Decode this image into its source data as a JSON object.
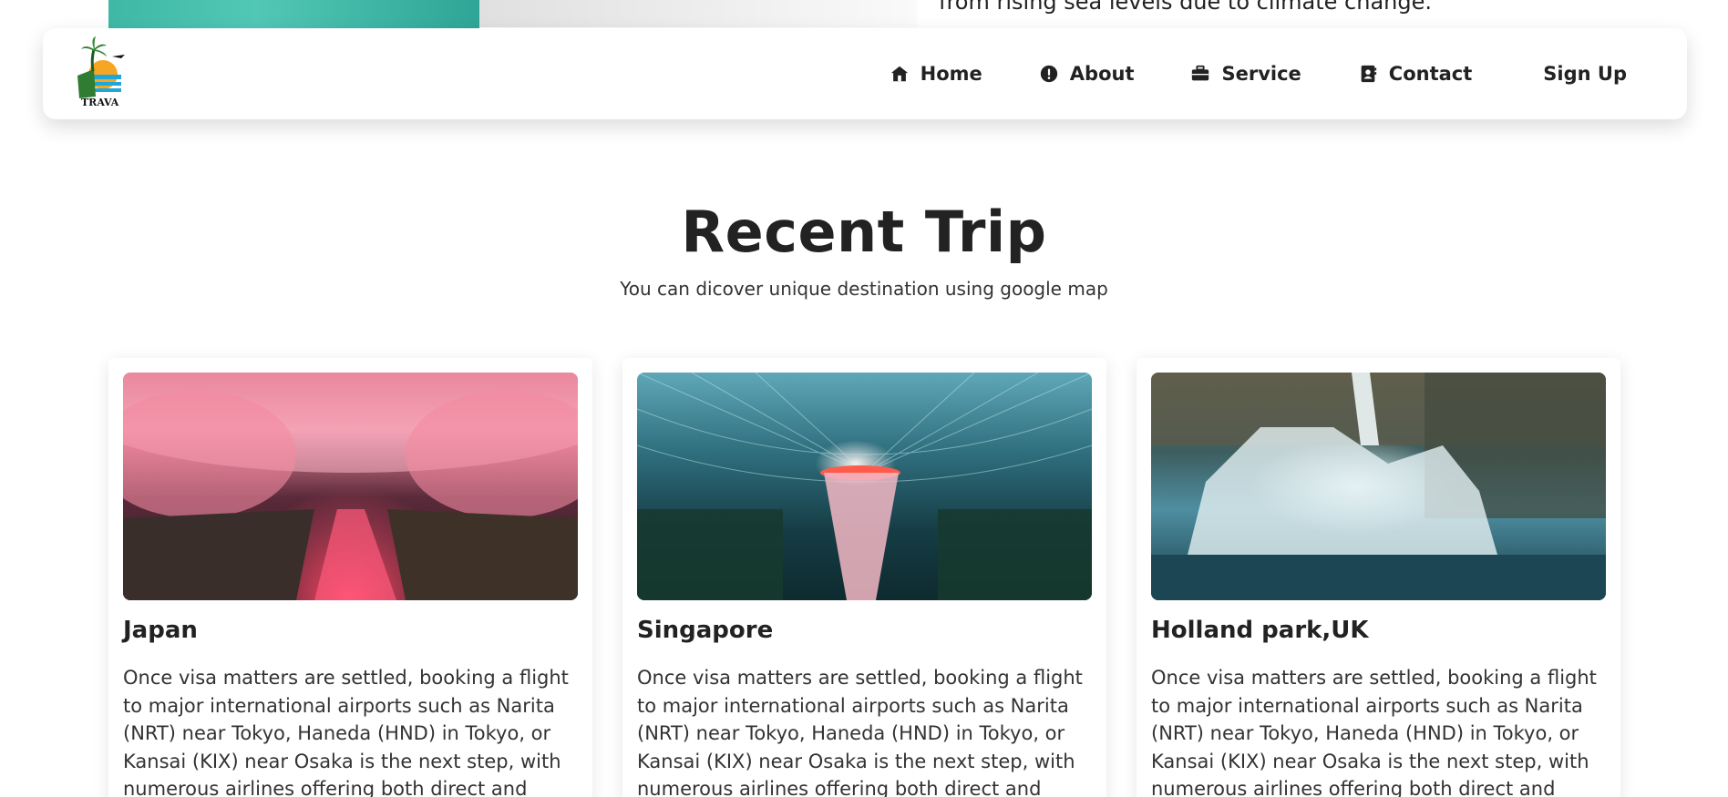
{
  "previous_section": {
    "text_fragment": "from rising sea levels due to climate change."
  },
  "brand": {
    "logo_text": "TRAVA",
    "logo_icon": "palm-tree-sunset-logo"
  },
  "nav": {
    "items": [
      {
        "label": "Home",
        "icon": "house-icon"
      },
      {
        "label": "About",
        "icon": "exclamation-circle-icon"
      },
      {
        "label": "Service",
        "icon": "briefcase-icon"
      },
      {
        "label": "Contact",
        "icon": "contact-book-icon"
      }
    ],
    "signup_label": "Sign Up"
  },
  "section": {
    "title": "Recent Trip",
    "subtitle": "You can dicover unique destination using google map"
  },
  "cards": [
    {
      "title": "Japan",
      "image": "cherry-blossom-canal-night",
      "text": "Once visa matters are settled, booking a flight to major international airports such as Narita (NRT) near Tokyo, Haneda (HND) in Tokyo, or Kansai (KIX) near Osaka is the next step, with numerous airlines offering both direct and connecting flights"
    },
    {
      "title": "Singapore",
      "image": "jewel-changi-rain-vortex",
      "text": "Once visa matters are settled, booking a flight to major international airports such as Narita (NRT) near Tokyo, Haneda (HND) in Tokyo, or Kansai (KIX) near Osaka is the next step, with numerous airlines offering both direct and connecting flights"
    },
    {
      "title": "Holland park,UK",
      "image": "waterfall-rocks",
      "text": "Once visa matters are settled, booking a flight to major international airports such as Narita (NRT) near Tokyo, Haneda (HND) in Tokyo, or Kansai (KIX) near Osaka is the next step, with numerous airlines offering both direct and connecting flights"
    }
  ],
  "colors": {
    "text": "#222222",
    "background": "#ffffff",
    "logo_green": "#2e7d32",
    "logo_orange": "#f5a623",
    "logo_blue": "#1ea7d8"
  }
}
